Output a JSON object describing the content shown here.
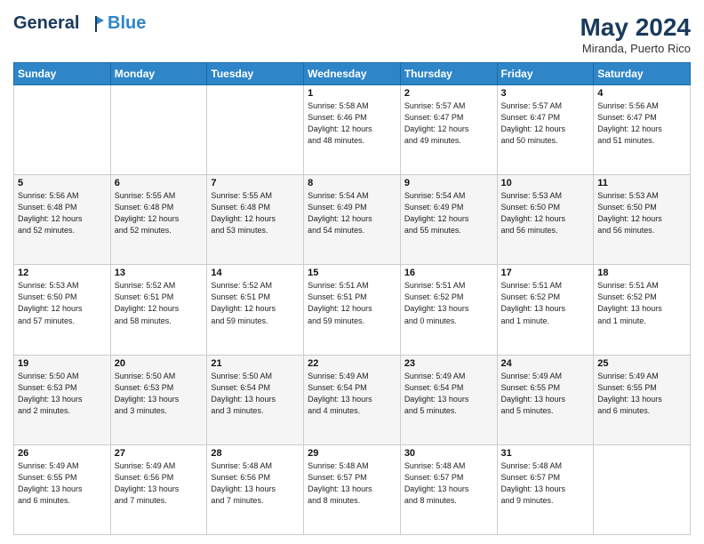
{
  "header": {
    "logo_line1": "General",
    "logo_line2": "Blue",
    "month": "May 2024",
    "location": "Miranda, Puerto Rico"
  },
  "weekdays": [
    "Sunday",
    "Monday",
    "Tuesday",
    "Wednesday",
    "Thursday",
    "Friday",
    "Saturday"
  ],
  "weeks": [
    [
      {
        "day": "",
        "info": ""
      },
      {
        "day": "",
        "info": ""
      },
      {
        "day": "",
        "info": ""
      },
      {
        "day": "1",
        "info": "Sunrise: 5:58 AM\nSunset: 6:46 PM\nDaylight: 12 hours\nand 48 minutes."
      },
      {
        "day": "2",
        "info": "Sunrise: 5:57 AM\nSunset: 6:47 PM\nDaylight: 12 hours\nand 49 minutes."
      },
      {
        "day": "3",
        "info": "Sunrise: 5:57 AM\nSunset: 6:47 PM\nDaylight: 12 hours\nand 50 minutes."
      },
      {
        "day": "4",
        "info": "Sunrise: 5:56 AM\nSunset: 6:47 PM\nDaylight: 12 hours\nand 51 minutes."
      }
    ],
    [
      {
        "day": "5",
        "info": "Sunrise: 5:56 AM\nSunset: 6:48 PM\nDaylight: 12 hours\nand 52 minutes."
      },
      {
        "day": "6",
        "info": "Sunrise: 5:55 AM\nSunset: 6:48 PM\nDaylight: 12 hours\nand 52 minutes."
      },
      {
        "day": "7",
        "info": "Sunrise: 5:55 AM\nSunset: 6:48 PM\nDaylight: 12 hours\nand 53 minutes."
      },
      {
        "day": "8",
        "info": "Sunrise: 5:54 AM\nSunset: 6:49 PM\nDaylight: 12 hours\nand 54 minutes."
      },
      {
        "day": "9",
        "info": "Sunrise: 5:54 AM\nSunset: 6:49 PM\nDaylight: 12 hours\nand 55 minutes."
      },
      {
        "day": "10",
        "info": "Sunrise: 5:53 AM\nSunset: 6:50 PM\nDaylight: 12 hours\nand 56 minutes."
      },
      {
        "day": "11",
        "info": "Sunrise: 5:53 AM\nSunset: 6:50 PM\nDaylight: 12 hours\nand 56 minutes."
      }
    ],
    [
      {
        "day": "12",
        "info": "Sunrise: 5:53 AM\nSunset: 6:50 PM\nDaylight: 12 hours\nand 57 minutes."
      },
      {
        "day": "13",
        "info": "Sunrise: 5:52 AM\nSunset: 6:51 PM\nDaylight: 12 hours\nand 58 minutes."
      },
      {
        "day": "14",
        "info": "Sunrise: 5:52 AM\nSunset: 6:51 PM\nDaylight: 12 hours\nand 59 minutes."
      },
      {
        "day": "15",
        "info": "Sunrise: 5:51 AM\nSunset: 6:51 PM\nDaylight: 12 hours\nand 59 minutes."
      },
      {
        "day": "16",
        "info": "Sunrise: 5:51 AM\nSunset: 6:52 PM\nDaylight: 13 hours\nand 0 minutes."
      },
      {
        "day": "17",
        "info": "Sunrise: 5:51 AM\nSunset: 6:52 PM\nDaylight: 13 hours\nand 1 minute."
      },
      {
        "day": "18",
        "info": "Sunrise: 5:51 AM\nSunset: 6:52 PM\nDaylight: 13 hours\nand 1 minute."
      }
    ],
    [
      {
        "day": "19",
        "info": "Sunrise: 5:50 AM\nSunset: 6:53 PM\nDaylight: 13 hours\nand 2 minutes."
      },
      {
        "day": "20",
        "info": "Sunrise: 5:50 AM\nSunset: 6:53 PM\nDaylight: 13 hours\nand 3 minutes."
      },
      {
        "day": "21",
        "info": "Sunrise: 5:50 AM\nSunset: 6:54 PM\nDaylight: 13 hours\nand 3 minutes."
      },
      {
        "day": "22",
        "info": "Sunrise: 5:49 AM\nSunset: 6:54 PM\nDaylight: 13 hours\nand 4 minutes."
      },
      {
        "day": "23",
        "info": "Sunrise: 5:49 AM\nSunset: 6:54 PM\nDaylight: 13 hours\nand 5 minutes."
      },
      {
        "day": "24",
        "info": "Sunrise: 5:49 AM\nSunset: 6:55 PM\nDaylight: 13 hours\nand 5 minutes."
      },
      {
        "day": "25",
        "info": "Sunrise: 5:49 AM\nSunset: 6:55 PM\nDaylight: 13 hours\nand 6 minutes."
      }
    ],
    [
      {
        "day": "26",
        "info": "Sunrise: 5:49 AM\nSunset: 6:55 PM\nDaylight: 13 hours\nand 6 minutes."
      },
      {
        "day": "27",
        "info": "Sunrise: 5:49 AM\nSunset: 6:56 PM\nDaylight: 13 hours\nand 7 minutes."
      },
      {
        "day": "28",
        "info": "Sunrise: 5:48 AM\nSunset: 6:56 PM\nDaylight: 13 hours\nand 7 minutes."
      },
      {
        "day": "29",
        "info": "Sunrise: 5:48 AM\nSunset: 6:57 PM\nDaylight: 13 hours\nand 8 minutes."
      },
      {
        "day": "30",
        "info": "Sunrise: 5:48 AM\nSunset: 6:57 PM\nDaylight: 13 hours\nand 8 minutes."
      },
      {
        "day": "31",
        "info": "Sunrise: 5:48 AM\nSunset: 6:57 PM\nDaylight: 13 hours\nand 9 minutes."
      },
      {
        "day": "",
        "info": ""
      }
    ]
  ]
}
